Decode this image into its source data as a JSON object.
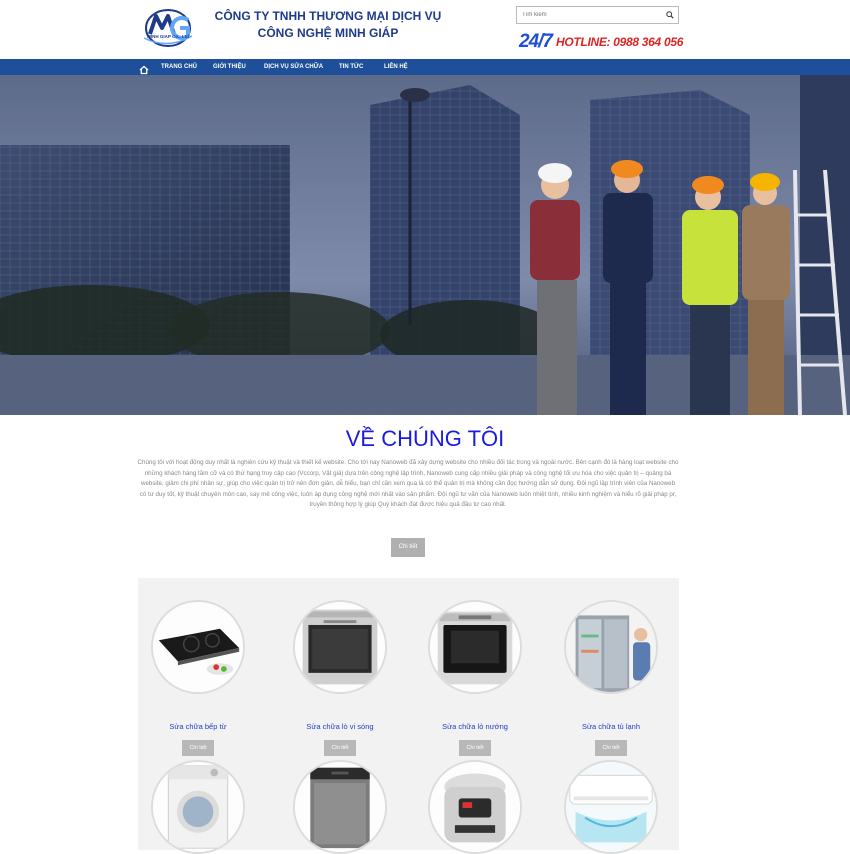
{
  "header": {
    "logo_caption": "MINH GIAP Co., Ltd",
    "company_line1": "CÔNG TY TNHH THƯƠNG MẠI DỊCH VỤ",
    "company_line2": "CÔNG NGHỆ MINH GIÁP",
    "search_placeholder": "Tìm kiếm",
    "hotline_247": "24/7",
    "hotline_text": "HOTLINE: 0988 364 056"
  },
  "nav": {
    "items": [
      "TRANG CHỦ",
      "GIỚI THIỆU",
      "DỊCH VỤ SỬA CHỮA",
      "TIN TỨC",
      "LIÊN HỆ"
    ]
  },
  "about": {
    "title": "VỀ CHÚNG TÔI",
    "text": "Chúng tôi với hoạt động duy nhất là nghiên cứu kỹ thuật và thiết kế website. Cho tới nay Nanoweb đã xây dựng website cho nhiều đối tác trong và ngoài nước. Bên cạnh đó là hàng loạt website cho những khách hàng tầm cỡ và có thứ hạng truy cập cao (Vccorp, Vật giá) dựa trên công nghệ lập trình, Nanoweb cung cấp nhiều giải pháp và công nghệ tối ưu hóa cho việc quản trị – quảng bá website, giảm chi phí nhân sự, giúp cho việc quản trị trở nên đơn giản, dễ hiểu, bạn chỉ cần xem qua là có thể quản trị mà không cần đọc hướng dẫn sử dụng. Đội ngũ lập trình viên của Nanoweb có tư duy tốt, kỹ thuật chuyên môn cao, say mê công việc, luôn áp dụng công nghệ mới nhất vào sản phẩm. Đội ngũ tư vấn của Nanoweb luôn nhiệt tình, nhiều kinh nghiệm và hiểu rõ giải pháp pr, truyền thông hợp lý giúp Quý khách đạt được hiệu quả đầu tư cao nhất.",
    "button": "Chi tiết"
  },
  "services": {
    "items": [
      {
        "label": "Sửa chữa bếp từ",
        "button": "Chi tiết",
        "icon": "induction-cooktop-image"
      },
      {
        "label": "Sửa chữa lò vi sóng",
        "button": "Chi tiết",
        "icon": "microwave-image"
      },
      {
        "label": "Sửa chữa lò nướng",
        "button": "Chi tiết",
        "icon": "oven-image"
      },
      {
        "label": "Sửa chữa tủ lạnh",
        "button": "Chi tiết",
        "icon": "refrigerator-image"
      },
      {
        "label": "",
        "button": "",
        "icon": "washing-machine-image"
      },
      {
        "label": "",
        "button": "",
        "icon": "dishwasher-image"
      },
      {
        "label": "",
        "button": "",
        "icon": "rice-cooker-image"
      },
      {
        "label": "",
        "button": "",
        "icon": "air-conditioner-image"
      }
    ]
  },
  "colors": {
    "nav": "#1e4f9a",
    "company": "#1e3a8a",
    "title": "#1a1ae0",
    "hotline": "#dc2626"
  }
}
